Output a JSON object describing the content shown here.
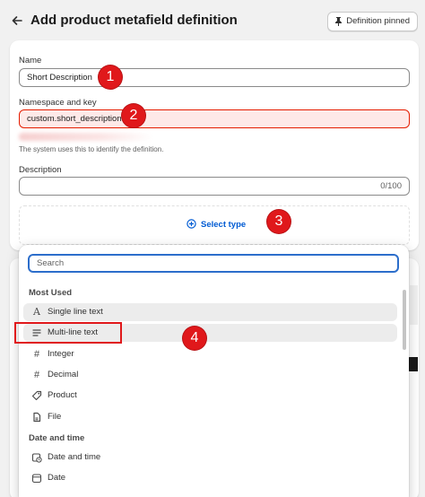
{
  "header": {
    "title": "Add product metafield definition",
    "pin_label": "Definition pinned"
  },
  "form": {
    "name_label": "Name",
    "name_value": "Short Description",
    "namespace_label": "Namespace and key",
    "namespace_value": "custom.short_description",
    "help_text": "The system uses this to identify the definition.",
    "description_label": "Description",
    "description_value": "",
    "description_counter": "0/100",
    "select_type_label": "Select type"
  },
  "badges": [
    "1",
    "2",
    "3",
    "4"
  ],
  "popover": {
    "search_placeholder": "Search",
    "sections": [
      {
        "title": "Most Used",
        "options": [
          {
            "label": "Single line text",
            "icon": "letter-a-icon",
            "highlighted": true
          },
          {
            "label": "Multi-line text",
            "icon": "lines-icon",
            "highlighted": true
          },
          {
            "label": "Integer",
            "icon": "hash-icon",
            "highlighted": false
          },
          {
            "label": "Decimal",
            "icon": "hash-icon",
            "highlighted": false
          },
          {
            "label": "Product",
            "icon": "tag-icon",
            "highlighted": false
          },
          {
            "label": "File",
            "icon": "file-icon",
            "highlighted": false
          }
        ]
      },
      {
        "title": "Date and time",
        "options": [
          {
            "label": "Date and time",
            "icon": "calendar-clock-icon",
            "highlighted": false
          },
          {
            "label": "Date",
            "icon": "calendar-icon",
            "highlighted": false
          }
        ]
      }
    ]
  },
  "colors": {
    "accent": "#005bd3",
    "error_bg": "#fee9e8",
    "badge": "#e0181b"
  }
}
